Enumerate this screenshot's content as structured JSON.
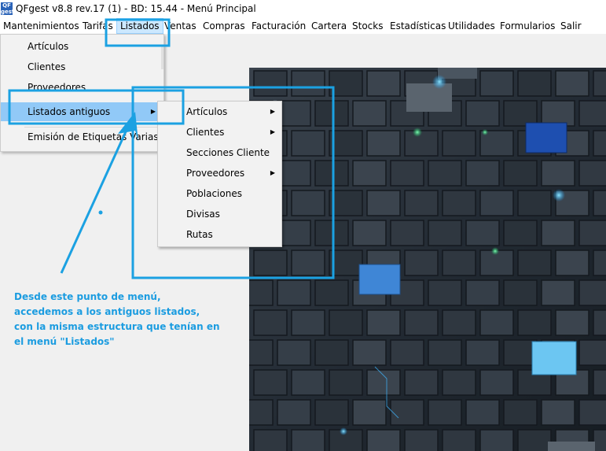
{
  "window": {
    "title": "QFgest v8.8 rev.17 (1) - BD: 15.44 - Menú Principal",
    "icon_label": "QF gest"
  },
  "menubar": {
    "items": [
      "Mantenimientos",
      "Tarifas",
      "Listados",
      "Ventas",
      "Compras",
      "Facturación",
      "Cartera",
      "Stocks",
      "Estadísticas",
      "Utilidades",
      "Formularios",
      "Salir"
    ],
    "active": "Listados"
  },
  "dropdown": {
    "items": [
      "Artículos",
      "Clientes",
      "Proveedores",
      "Listados antiguos",
      "Emisión de Etiquetas Varias"
    ],
    "highlighted": "Listados antiguos"
  },
  "submenu": {
    "items": [
      {
        "label": "Artículos",
        "has_submenu": true
      },
      {
        "label": "Clientes",
        "has_submenu": true
      },
      {
        "label": "Secciones Cliente",
        "has_submenu": false
      },
      {
        "label": "Proveedores",
        "has_submenu": true
      },
      {
        "label": "Poblaciones",
        "has_submenu": false
      },
      {
        "label": "Divisas",
        "has_submenu": false
      },
      {
        "label": "Rutas",
        "has_submenu": false
      }
    ]
  },
  "annotation": {
    "lines": [
      "Desde este punto de menú,",
      "accedemos a los antiguos listados,",
      "con la misma estructura que tenían en",
      "el menú \"Listados\""
    ]
  },
  "colors": {
    "annotation": "#1b9ce0",
    "highlight": "#91c9f7",
    "menu_active": "#cce8ff"
  },
  "icons": {
    "submenu_arrow": "triangle-right-icon"
  }
}
